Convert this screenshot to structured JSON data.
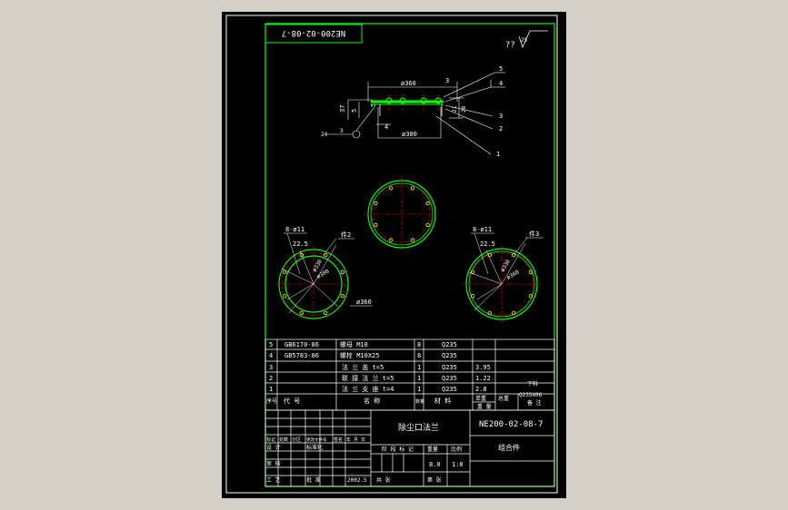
{
  "drawing": {
    "rotated_code": "NE200-02-08-7",
    "roughness": {
      "mark": "??",
      "value": "25"
    },
    "center_title": "除尘口法兰",
    "drawing_number": "NE200-02-08-7",
    "assembly_label": "组合件",
    "scale": "1:8",
    "weight": "8.0",
    "date": "2002.5"
  },
  "section_view": {
    "dims": {
      "d360": "ø360",
      "d300": "ø300",
      "h37": "37",
      "h5a": "5",
      "h5b": "5",
      "w4": "4",
      "d3": "3",
      "v21": "21",
      "v28": "28"
    },
    "leaders": [
      "5",
      "4",
      "3",
      "2",
      "1"
    ]
  },
  "piece_views": {
    "left": {
      "label": "件2",
      "holes": "8-ø11",
      "angle": "22.5",
      "d330": "ø330",
      "d300": "ø300",
      "d360": "ø360"
    },
    "right": {
      "label": "件3",
      "holes": "8-ø11",
      "angle": "22.5",
      "d330": "ø330",
      "d360": "ø360"
    }
  },
  "bom": {
    "rows": [
      {
        "no": "5",
        "code": "GB6170-86",
        "name": "螺母 M10",
        "qty": "8",
        "material": "Q235",
        "unit": "",
        "total": ""
      },
      {
        "no": "4",
        "code": "GB5783-86",
        "name": "螺栓 M10X25",
        "qty": "8",
        "material": "Q235",
        "unit": "",
        "total": ""
      },
      {
        "no": "3",
        "code": "",
        "name": "法 兰 盖 t=5",
        "qty": "1",
        "material": "Q235",
        "unit": "3.95",
        "total": ""
      },
      {
        "no": "2",
        "code": "",
        "name": "联 接 法 兰 t=5",
        "qty": "1",
        "material": "Q235",
        "unit": "1.22",
        "total": ""
      },
      {
        "no": "1",
        "code": "",
        "name": "法 兰 支 座 t=4",
        "qty": "1",
        "material": "Q235",
        "unit": "2.8",
        "total": ""
      }
    ],
    "side_note": "下料",
    "side_note_sub": "Q235X06",
    "headers": {
      "no": "序号",
      "code": "代 号",
      "name": "名 称",
      "qty": "数量",
      "material": "材 料",
      "unit_weight": "单重",
      "total_weight": "总重",
      "unit_row": "重 量",
      "remark": "备 注"
    }
  },
  "title_block": {
    "left_labels": {
      "l1": "标记",
      "l2": "处数",
      "l3": "分区",
      "l4": "更改文件号",
      "l5": "签名",
      "l6": "年 月 日",
      "design": "设 计",
      "std": "标准化",
      "check": "审 核",
      "process": "工 艺",
      "approve": "批 准"
    },
    "stage_labels": {
      "stage": "阶 段 标 记",
      "weight": "重量",
      "scale": "比例",
      "sheets": "共 张",
      "sheet": "第 张"
    }
  }
}
